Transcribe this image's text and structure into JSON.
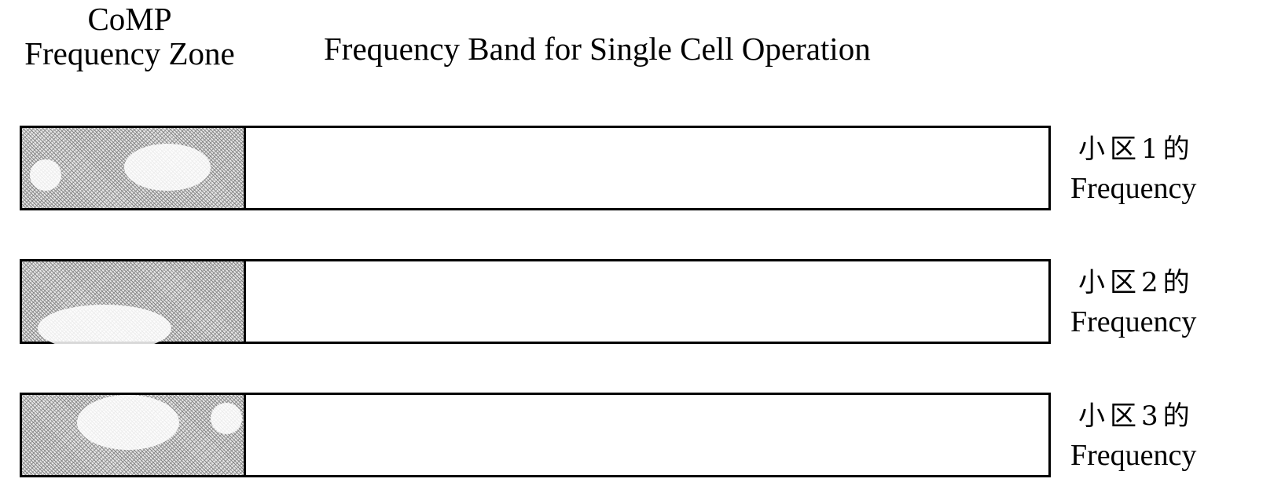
{
  "header": {
    "comp_zone_line1": "CoMP",
    "comp_zone_line2": "Frequency Zone",
    "single_cell_band": "Frequency Band for Single Cell Operation"
  },
  "rows": [
    {
      "cell_line1": "小区1的",
      "cell_line2": "Frequency"
    },
    {
      "cell_line1": "小区2的",
      "cell_line2": "Frequency"
    },
    {
      "cell_line1": "小区3的",
      "cell_line2": "Frequency"
    }
  ],
  "colors": {
    "line": "#000000",
    "hatch": "#888888",
    "background": "#ffffff"
  }
}
